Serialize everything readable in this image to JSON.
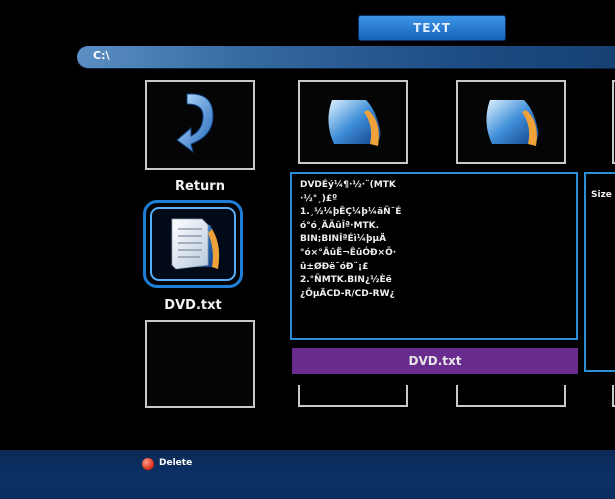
{
  "header": {
    "tab_label": "TEXT"
  },
  "path": {
    "current": "C:\\"
  },
  "files": {
    "return_label": "Return",
    "selected_label": "DVD.txt"
  },
  "preview": {
    "lines": [
      "DVDÉý¼¶·½·¨(MTK",
      "·½°¸)£º",
      "1.¸½¼þÊÇ¼þ¼äÑ¯É",
      "ó°ó¸ÄÃûÎª·MTK.",
      "BIN;BINÎªÉì¼þµÄ",
      "°ó×°ÂûË¬ÊûÓÐ×Ö·",
      "û±ØÐë¯óÐ¨¡£",
      "2.°ÑMTK.BIN¿½Èë",
      "¿ÕµÄCD-R/CD-RW¿"
    ],
    "filename": "DVD.txt"
  },
  "info": {
    "size_label": "Size"
  },
  "footer": {
    "delete_label": "Delete"
  },
  "colors": {
    "accent": "#1e7fd8",
    "namebar": "#6a2b8f",
    "delete": "#d62a10"
  },
  "icons": [
    "folder-icon",
    "return-arrow-icon",
    "text-file-icon"
  ]
}
